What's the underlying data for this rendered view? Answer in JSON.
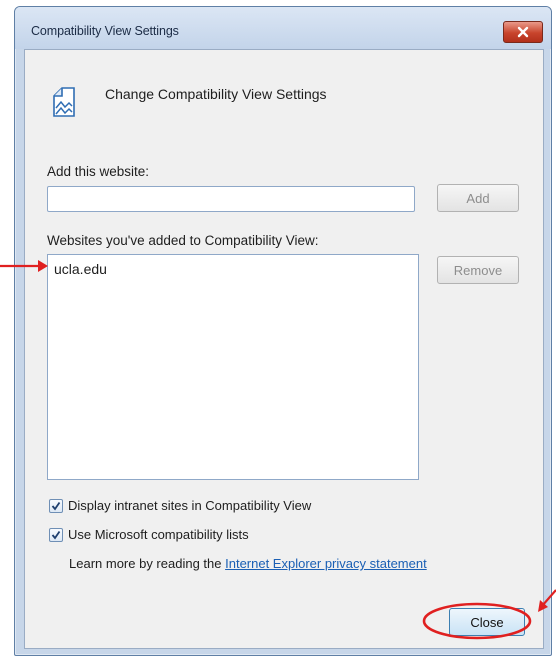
{
  "dialog": {
    "title": "Compatibility View Settings",
    "header_text": "Change Compatibility View Settings",
    "add_label": "Add this website:",
    "add_value": "",
    "add_button": "Add",
    "list_label": "Websites you've added to Compatibility View:",
    "sites": [
      "ucla.edu"
    ],
    "remove_button": "Remove",
    "checkboxes": [
      {
        "label": "Display intranet sites in Compatibility View",
        "checked": true
      },
      {
        "label": "Use Microsoft compatibility lists",
        "checked": true
      }
    ],
    "learn_prefix": "Learn more by reading the ",
    "learn_link": "Internet Explorer privacy statement",
    "close_button": "Close"
  },
  "annotation": {
    "color": "#e02020"
  }
}
